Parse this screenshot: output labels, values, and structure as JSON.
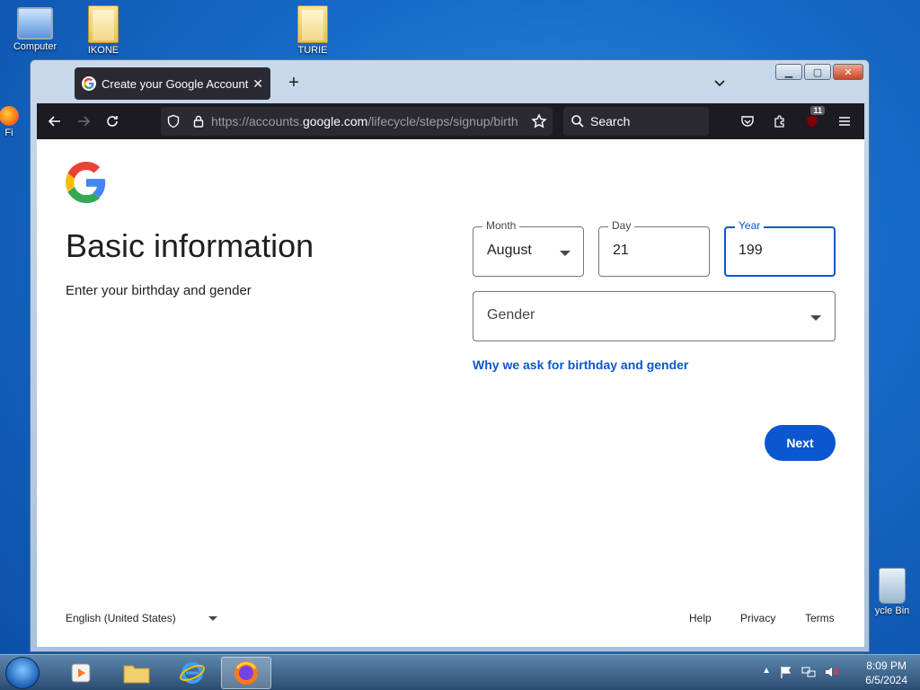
{
  "desktop": {
    "icons": [
      {
        "label": "Computer"
      },
      {
        "label": "IKONE"
      },
      {
        "label": "TURIE"
      },
      {
        "label": "Fi"
      },
      {
        "label": "ycle Bin"
      }
    ]
  },
  "browser": {
    "tab_title": "Create your Google Account",
    "tab_close": "✕",
    "new_tab": "+",
    "url_prefix": "https://accounts.",
    "url_domain": "google.com",
    "url_path": "/lifecycle/steps/signup/birth",
    "search_placeholder": "Search",
    "extension_badge": "11"
  },
  "page": {
    "heading": "Basic information",
    "subheading": "Enter your birthday and gender",
    "month": {
      "label": "Month",
      "value": "August"
    },
    "day": {
      "label": "Day",
      "value": "21"
    },
    "year": {
      "label": "Year",
      "value": "199"
    },
    "gender": {
      "placeholder": "Gender"
    },
    "why_link": "Why we ask for birthday and gender",
    "next_button": "Next",
    "footer": {
      "language": "English (United States)",
      "help": "Help",
      "privacy": "Privacy",
      "terms": "Terms"
    }
  },
  "taskbar": {
    "time": "8:09 PM",
    "date": "6/5/2024"
  },
  "colors": {
    "google_blue": "#0b57d0",
    "browser_dark": "#1c1b22"
  }
}
